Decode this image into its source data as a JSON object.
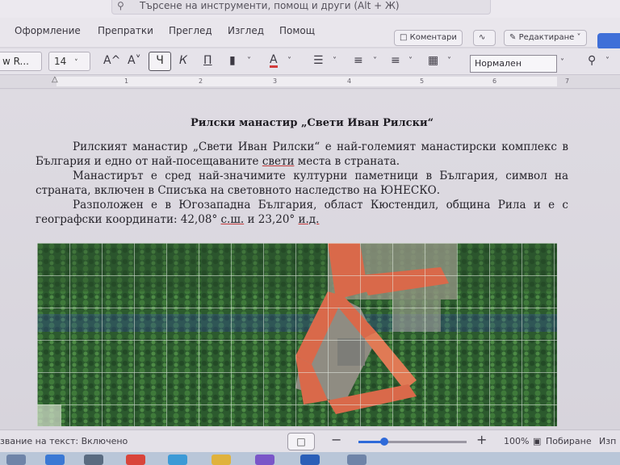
{
  "search": {
    "placeholder": "Търсене на инструменти, помощ и други (Alt + Ж)"
  },
  "tabs": [
    {
      "label": "Оформление"
    },
    {
      "label": "Препратки"
    },
    {
      "label": "Преглед"
    },
    {
      "label": "Изглед"
    },
    {
      "label": "Помощ"
    }
  ],
  "ribbon_right": {
    "comments_label": "Коментари",
    "editing_label": "Редактиране"
  },
  "toolbar": {
    "font_name": "w R...",
    "font_size": "14",
    "grow": "A^",
    "shrink": "A˅",
    "bold": "Ч",
    "italic": "К",
    "underline": "П",
    "font_color": "A",
    "style": "Нормален"
  },
  "ruler": {
    "ticks": [
      "1",
      "2",
      "3",
      "4",
      "5",
      "6",
      "7"
    ]
  },
  "document": {
    "title": "Рилски манастир „Свети Иван Рилски“",
    "p1": "Рилският манастир „Свети Иван Рилски“ е най-големият манастирски комплекс в България и едно от най-посещаваните",
    "p1_u": "свети",
    "p1_end": "места в страната.",
    "p2": "Манастирът е сред най-значимите културни паметници в България, символ на страната, включен в Списъка на световното наследство на ЮНЕСКО.",
    "p3": "Разположен е в Югозападна България, област Кюстендил, община Рила и е с географски координати: 42,08°",
    "p3_u1": "с.ш.",
    "p3_mid": "и 23,20°",
    "p3_u2": "и.д."
  },
  "status": {
    "text_prediction": "звание на текст: Включено",
    "zoom_percent": "100%",
    "zoom_level": 0.24,
    "fit": "Побиране",
    "trailing": "Изп"
  },
  "colors": {
    "accent": "#3f6fd8",
    "forest": "#2e5a2c",
    "roof": "#d9694a"
  }
}
